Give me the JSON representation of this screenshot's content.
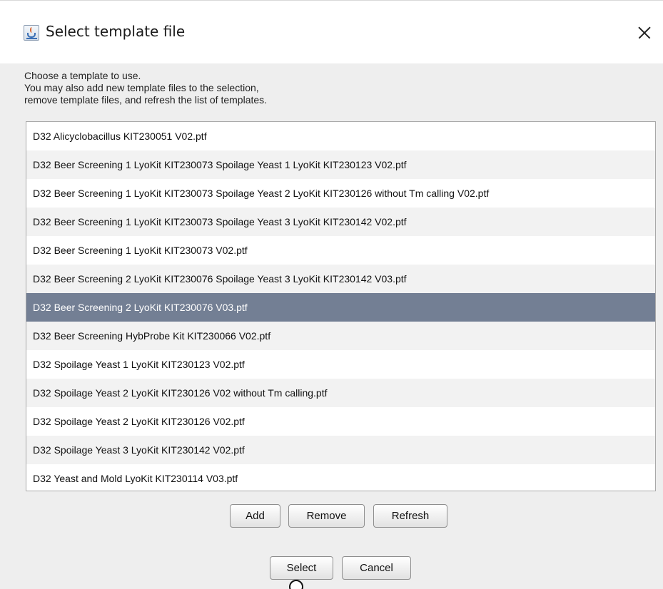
{
  "window": {
    "title": "Select template file",
    "icon": "java-cup-icon",
    "close_glyph": "✕"
  },
  "instructions": {
    "line1": "Choose a template to use.",
    "line2": "You may also add new template files to the selection,",
    "line3": "remove template files, and refresh the list of templates."
  },
  "templates": [
    "D32 Alicyclobacillus KIT230051 V02.ptf",
    "D32 Beer Screening 1 LyoKit KIT230073 Spoilage Yeast 1 LyoKit KIT230123 V02.ptf",
    "D32 Beer Screening 1 LyoKit KIT230073 Spoilage Yeast 2 LyoKit KIT230126 without Tm calling V02.ptf",
    "D32 Beer Screening 1 LyoKit KIT230073 Spoilage Yeast 3 LyoKit KIT230142 V02.ptf",
    "D32 Beer Screening 1 LyoKit KIT230073 V02.ptf",
    "D32 Beer Screening 2 LyoKit KIT230076 Spoilage Yeast 3 LyoKit KIT230142 V03.ptf",
    "D32 Beer Screening 2 LyoKit KIT230076 V03.ptf",
    "D32 Beer Screening HybProbe Kit KIT230066 V02.ptf",
    "D32 Spoilage Yeast 1 LyoKit KIT230123 V02.ptf",
    "D32 Spoilage Yeast 2 LyoKit KIT230126 V02 without Tm calling.ptf",
    "D32 Spoilage Yeast 2 LyoKit KIT230126 V02.ptf",
    "D32 Spoilage Yeast 3 LyoKit KIT230142 V02.ptf",
    "D32 Yeast and Mold LyoKit KIT230114 V03.ptf"
  ],
  "selected_template": "D32 Beer Screening 2 LyoKit KIT230076 V03.ptf",
  "actions": {
    "add": "Add",
    "remove": "Remove",
    "refresh": "Refresh"
  },
  "footer": {
    "select": "Select",
    "cancel": "Cancel"
  },
  "colors": {
    "selection": "#737f94",
    "window_bg": "#eeeeee"
  }
}
